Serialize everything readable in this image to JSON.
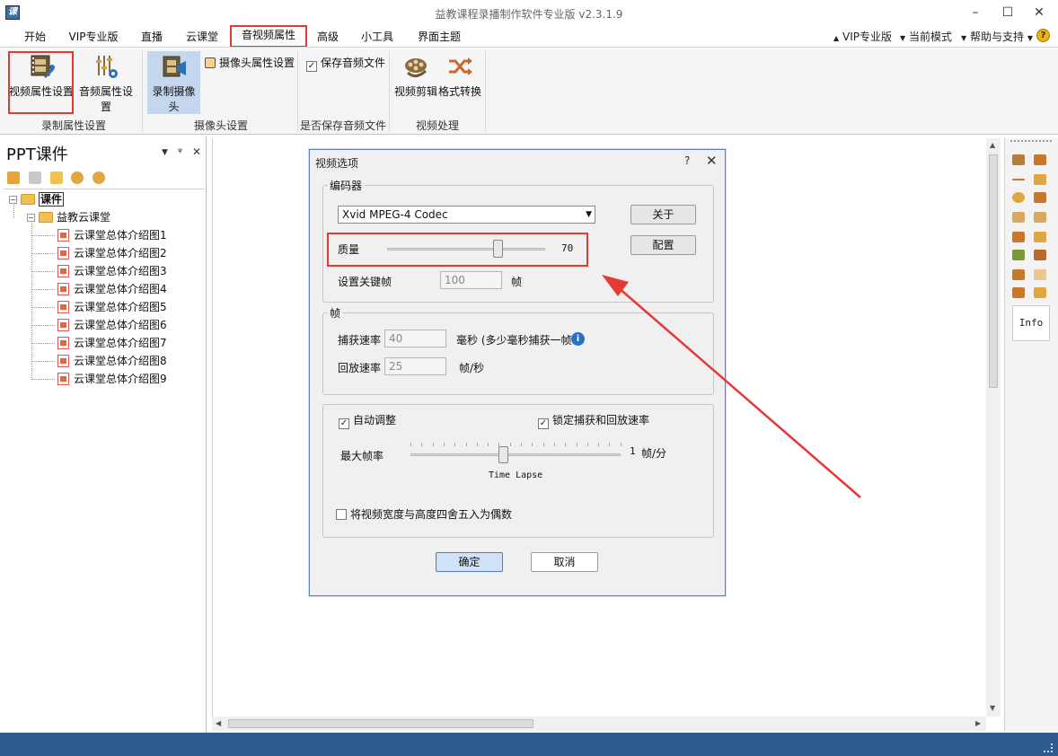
{
  "window": {
    "title": "益教课程录播制作软件专业版 v2.3.1.9",
    "app_icon_text": "课"
  },
  "menu": {
    "items": [
      "开始",
      "VIP专业版",
      "直播",
      "云课堂",
      "音视频属性",
      "高级",
      "小工具",
      "界面主题"
    ],
    "active": "音视频属性",
    "right": [
      "VIP专业版",
      "当前模式",
      "帮助与支持"
    ]
  },
  "ribbon": {
    "group1": {
      "label": "录制属性设置",
      "buttons": [
        "视频属性设置",
        "音频属性设置"
      ]
    },
    "group2": {
      "label": "摄像头设置",
      "button": "录制摄像头",
      "small": "摄像头属性设置"
    },
    "group3": {
      "label": "是否保存音频文件",
      "checkbox": "保存音频文件",
      "checked": true
    },
    "group4": {
      "label": "视频处理",
      "buttons": [
        "视频剪辑",
        "格式转换"
      ]
    }
  },
  "left_panel": {
    "title": "PPT课件",
    "root": "课件",
    "folder": "益教云课堂",
    "items": [
      "云课堂总体介绍图1",
      "云课堂总体介绍图2",
      "云课堂总体介绍图3",
      "云课堂总体介绍图4",
      "云课堂总体介绍图5",
      "云课堂总体介绍图6",
      "云课堂总体介绍图7",
      "云课堂总体介绍图8",
      "云课堂总体介绍图9"
    ]
  },
  "right_strip": {
    "info_label": "Info"
  },
  "dialog": {
    "title": "视频选项",
    "help": "?",
    "close": "✕",
    "encoder": {
      "legend": "编码器",
      "codec": "Xvid MPEG-4 Codec",
      "about": "关于",
      "config": "配置",
      "quality_label": "质量",
      "quality_value": "70",
      "quality_fraction": 0.7,
      "keyframe_label": "设置关键帧",
      "keyframe_value": "100",
      "keyframe_unit": "帧"
    },
    "frames": {
      "legend": "帧",
      "capture_label": "捕获速率",
      "capture_value": "40",
      "capture_unit": "毫秒 (多少毫秒捕获一帧",
      "playback_label": "回放速率",
      "playback_value": "25",
      "playback_unit": "帧/秒"
    },
    "auto": {
      "auto_adjust": "自动调整",
      "auto_checked": true,
      "lock_rate": "锁定捕获和回放速率",
      "lock_checked": true,
      "max_rate_label": "最大帧率",
      "max_rate_value": "1",
      "max_rate_unit": "帧/分",
      "timelapse": "Time Lapse",
      "round_even": "将视频宽度与高度四舍五入为偶数",
      "round_checked": false
    },
    "ok": "确定",
    "cancel": "取消"
  },
  "colors": {
    "annotation_red": "#e53935",
    "status_blue": "#2f5b8f"
  }
}
